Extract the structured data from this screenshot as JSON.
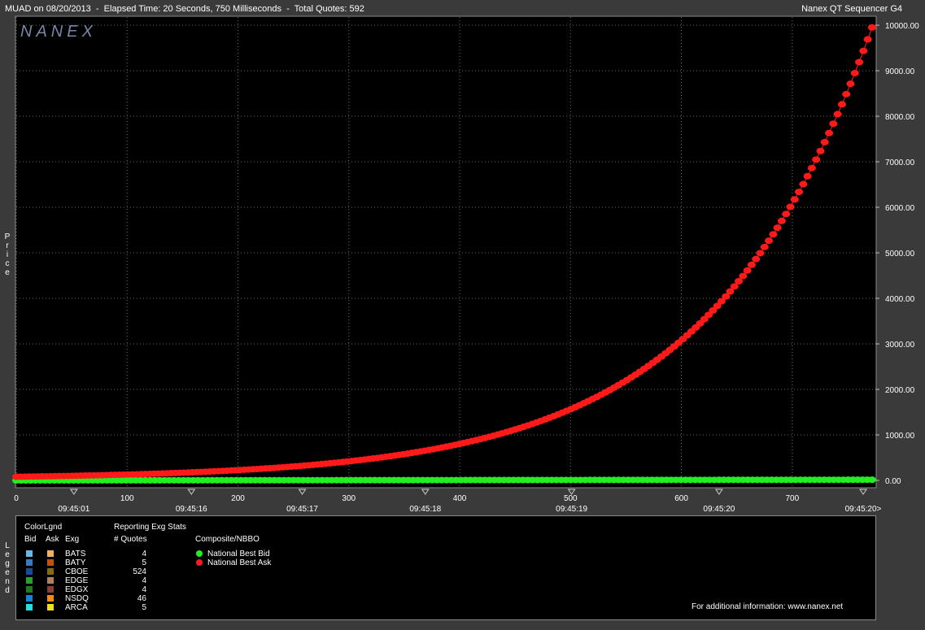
{
  "header": {
    "title": "MUAD on 08/20/2013  -  Elapsed Time: 20 Seconds, 750 Milliseconds  -  Total Quotes: 592",
    "app": "Nanex QT Sequencer G4"
  },
  "logo": "NANEX",
  "side_label": "Price",
  "legend_side_label": "Legend",
  "colors": {
    "background": "#3a3a3a",
    "plot_bg": "#000000",
    "grid": "#6a6a6a",
    "bid": "#22ee22",
    "ask": "#ff1a1a"
  },
  "chart_data": {
    "type": "scatter",
    "title": "",
    "xlabel": "",
    "ylabel": "Price",
    "x_ticks": [
      0,
      100,
      200,
      300,
      400,
      500,
      600,
      700
    ],
    "xlim": [
      0,
      775
    ],
    "ylim": [
      0,
      10000
    ],
    "y_ticks": [
      "0.00",
      "1000.00",
      "2000.00",
      "3000.00",
      "4000.00",
      "5000.00",
      "6000.00",
      "7000.00",
      "8000.00",
      "9000.00",
      "10000.00"
    ],
    "time_ticks": [
      {
        "seq": 52,
        "label": "09:45:01"
      },
      {
        "seq": 158,
        "label": "09:45:16"
      },
      {
        "seq": 258,
        "label": "09:45:17"
      },
      {
        "seq": 369,
        "label": "09:45:18"
      },
      {
        "seq": 501,
        "label": "09:45:19"
      },
      {
        "seq": 634,
        "label": "09:45:20"
      },
      {
        "seq": 764,
        "label": "09:45:20>"
      }
    ],
    "grid": true,
    "series": [
      {
        "name": "National Best Bid",
        "color": "#22ee22",
        "x_start": 0,
        "x_end": 772,
        "points": 180,
        "curve": "flat",
        "y_start": 0,
        "y_end": 15
      },
      {
        "name": "National Best Ask",
        "color": "#ff1a1a",
        "x_start": 0,
        "x_end": 772,
        "points": 200,
        "curve": "exponential",
        "y_start": 80,
        "y_end": 9950,
        "growth": 5.3
      }
    ]
  },
  "legend": {
    "color_legend_title": "ColorLgnd",
    "bid_header": "Bid",
    "ask_header": "Ask",
    "exg_header": "Exg",
    "stats_title": "Reporting Exg Stats",
    "quotes_header": "# Quotes",
    "composite_title": "Composite/NBBO",
    "exchanges": [
      {
        "name": "BATS",
        "quotes": "4",
        "bid_color": "#6ab4e8",
        "ask_color": "#f0b060"
      },
      {
        "name": "BATY",
        "quotes": "5",
        "bid_color": "#3a78c0",
        "ask_color": "#c05010"
      },
      {
        "name": "CBOE",
        "quotes": "524",
        "bid_color": "#184c8c",
        "ask_color": "#8a6a10"
      },
      {
        "name": "EDGE",
        "quotes": "4",
        "bid_color": "#2aa02a",
        "ask_color": "#b08060"
      },
      {
        "name": "EDGX",
        "quotes": "4",
        "bid_color": "#1e7a1e",
        "ask_color": "#8a4030"
      },
      {
        "name": "NSDQ",
        "quotes": "46",
        "bid_color": "#1a80e0",
        "ask_color": "#f08c10"
      },
      {
        "name": "ARCA",
        "quotes": "5",
        "bid_color": "#20e0e0",
        "ask_color": "#f0e020"
      }
    ],
    "nbbo": [
      {
        "label": "National Best Bid",
        "color": "#22ee22"
      },
      {
        "label": "National Best Ask",
        "color": "#ff1a1a"
      }
    ],
    "footer": "For additional information: www.nanex.net"
  }
}
